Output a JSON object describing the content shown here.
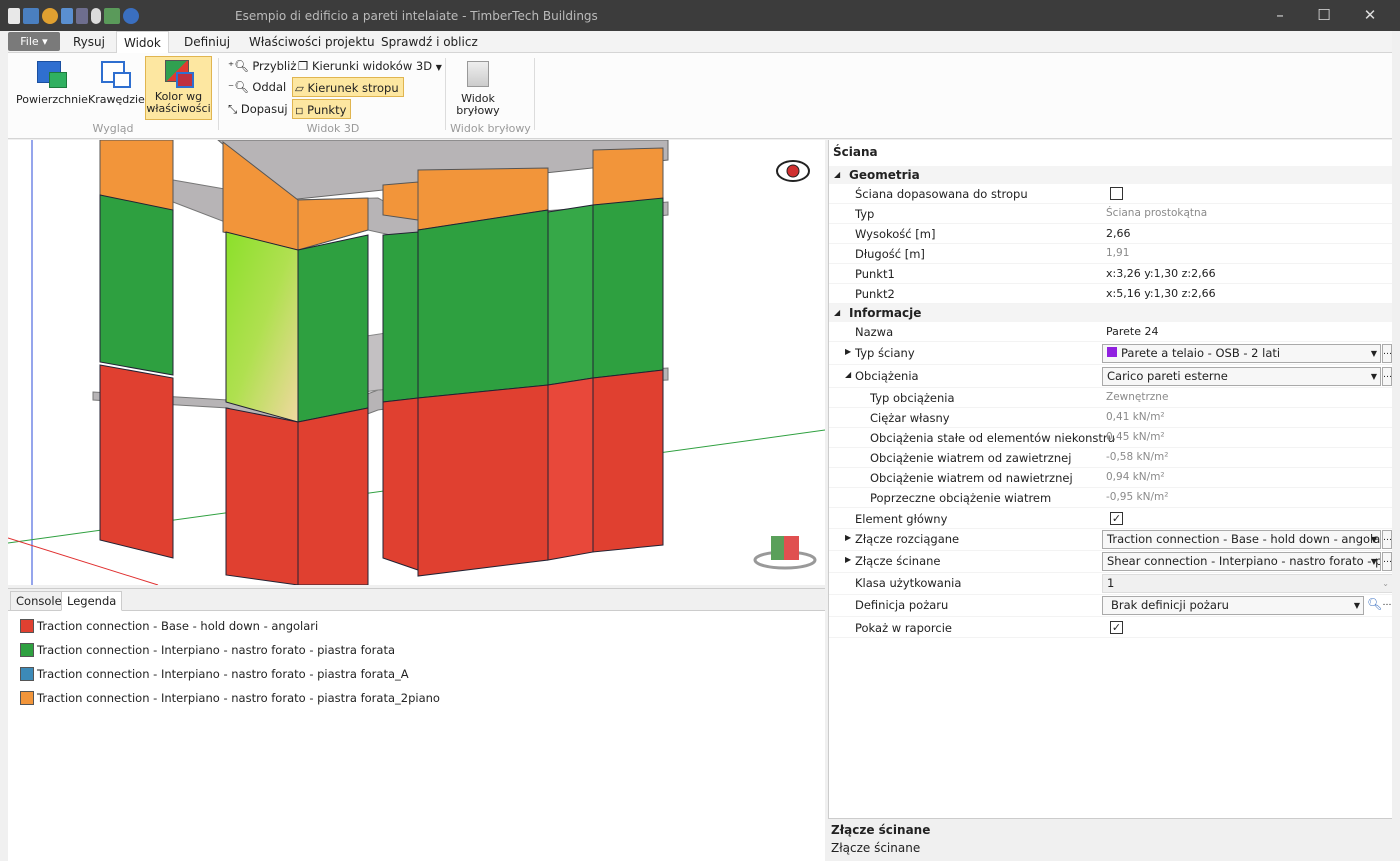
{
  "window": {
    "title": "Esempio di edificio a pareti intelaiate - TimberTech Buildings",
    "minimize": "–",
    "maximize": "☐",
    "close": "✕"
  },
  "tabs": [
    "File ▾",
    "Rysuj",
    "Widok",
    "Definiuj",
    "Właściwości projektu",
    "Sprawdź i oblicz"
  ],
  "active_tab": "Widok",
  "ribbon": {
    "wyglad": {
      "label": "Wygląd",
      "surfaces": "Powierzchnie",
      "edges": "Krawędzie",
      "color_line1": "Kolor wg",
      "color_line2": "właściwości"
    },
    "widok3d": {
      "label": "Widok 3D",
      "zoom_in": "Przybliż",
      "zoom_out": "Oddal",
      "fit": "Dopasuj",
      "view_directions": "Kierunki widoków 3D",
      "slab_direction": "Kierunek stropu",
      "points": "Punkty"
    },
    "solid": {
      "label": "Widok bryłowy",
      "btn_line1": "Widok",
      "btn_line2": "bryłowy"
    }
  },
  "bottom_panel": {
    "tabs": [
      "Console",
      "Legenda"
    ],
    "active": "Legenda",
    "legend": [
      {
        "color": "#e04030",
        "label": "Traction connection  - Base - hold down - angolari"
      },
      {
        "color": "#2ea040",
        "label": "Traction connection  - Interpiano - nastro forato - piastra forata"
      },
      {
        "color": "#3c8ab8",
        "label": "Traction connection  - Interpiano - nastro forato - piastra forata_A"
      },
      {
        "color": "#f2953a",
        "label": "Traction connection  - Interpiano - nastro forato - piastra forata_2piano"
      }
    ]
  },
  "properties": {
    "header": "Ściana",
    "geometria": {
      "label": "Geometria",
      "rows": [
        {
          "k": "Ściana dopasowana do stropu",
          "v": ""
        },
        {
          "k": "Typ",
          "v": "Ściana prostokątna"
        },
        {
          "k": "Wysokość [m]",
          "v": "2,66"
        },
        {
          "k": "Długość [m]",
          "v": "1,91"
        },
        {
          "k": "Punkt1",
          "v": "x:3,26 y:1,30 z:2,66"
        },
        {
          "k": "Punkt2",
          "v": "x:5,16 y:1,30 z:2,66"
        }
      ]
    },
    "informacje": {
      "label": "Informacje",
      "nazwa_k": "Nazwa",
      "nazwa_v": "Parete 24",
      "typ_sciany_k": "Typ ściany",
      "typ_sciany_v": "Parete a telaio - OSB - 2 lati",
      "obciazenia_k": "Obciążenia",
      "obciazenia_v": "Carico pareti esterne",
      "sub": [
        {
          "k": "Typ obciążenia",
          "v": "Zewnętrzne"
        },
        {
          "k": "Ciężar własny",
          "v": "0,41 kN/m²"
        },
        {
          "k": "Obciążenia stałe od elementów niekonstru...",
          "v": "0,45 kN/m²"
        },
        {
          "k": "Obciążenie wiatrem od zawietrznej",
          "v": "-0,58 kN/m²"
        },
        {
          "k": "Obciążenie wiatrem od nawietrznej",
          "v": "0,94 kN/m²"
        },
        {
          "k": "Poprzeczne obciążenie wiatrem",
          "v": "-0,95 kN/m²"
        }
      ],
      "element_k": "Element główny",
      "rozc_k": "Złącze rozciągane",
      "rozc_v": "Traction connection  - Base - hold down - angolar",
      "scin_k": "Złącze ścinane",
      "scin_v": "Shear connection  - Interpiano - nastro forato - pi",
      "klasa_k": "Klasa użytkowania",
      "klasa_v": "1",
      "pozar_k": "Definicja pożaru",
      "pozar_v": "Brak definicji pożaru",
      "raport_k": "Pokaż w raporcie"
    }
  },
  "description": {
    "title": "Złącze ścinane",
    "text": "Złącze ścinane"
  },
  "colors": {
    "wall_red": "#e04030",
    "wall_green": "#2ea040",
    "wall_orange": "#f2953a",
    "slab_grey": "#b7b4b6",
    "highlight": "#fde7a1"
  }
}
